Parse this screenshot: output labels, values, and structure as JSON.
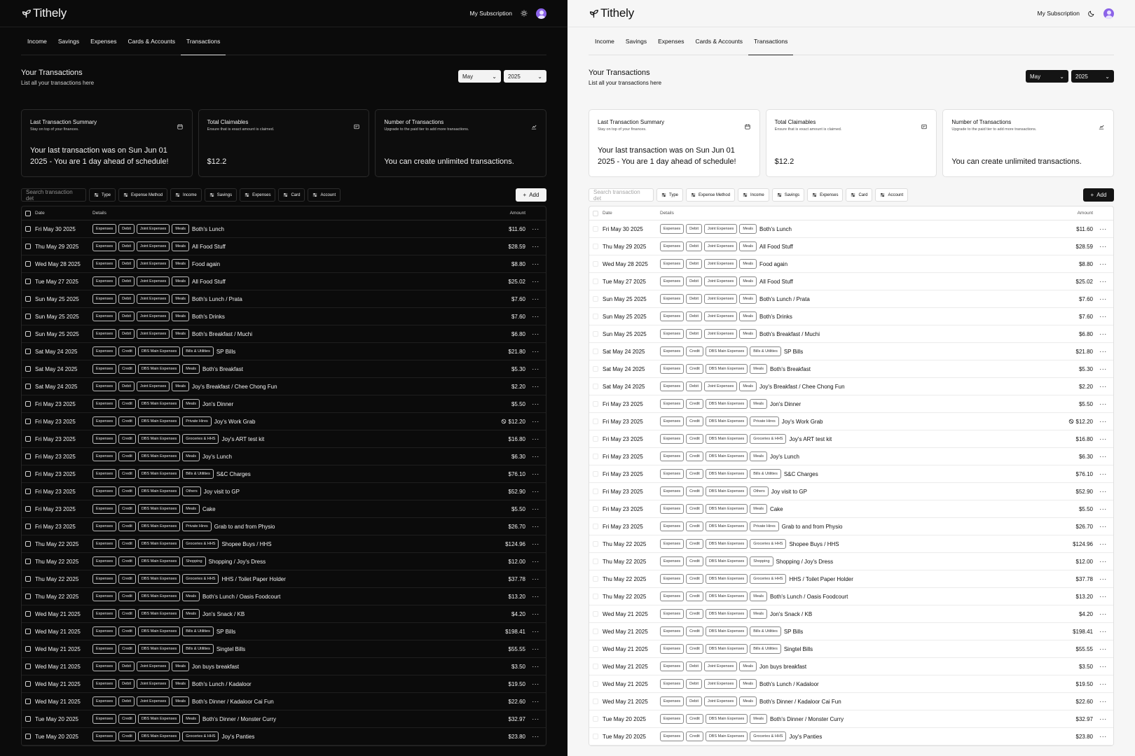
{
  "app": {
    "name": "Tithely",
    "subscription_label": "My Subscription"
  },
  "tabs": [
    "Income",
    "Savings",
    "Expenses",
    "Cards & Accounts",
    "Transactions"
  ],
  "active_tab": "Transactions",
  "page": {
    "title": "Your Transactions",
    "subtitle": "List all your transactions here"
  },
  "month_select": "May",
  "year_select": "2025",
  "cards": [
    {
      "title": "Last Transaction Summary",
      "subtitle": "Stay on top of your finances.",
      "value": "Your last transaction was on Sun Jun 01 2025 - You are 1 day ahead of schedule!",
      "icon": "calendar-icon"
    },
    {
      "title": "Total Claimables",
      "subtitle": "Ensure that is exact amount is claimed.",
      "value": "$12.2",
      "icon": "receipt-icon"
    },
    {
      "title": "Number of Transactions",
      "subtitle": "Upgrade to the paid tier to add more transactions.",
      "value": "You can create unlimited transactions.",
      "icon": "chart-icon"
    }
  ],
  "search_placeholder": "Search transaction det",
  "filters": [
    "Type",
    "Expense Method",
    "Income",
    "Savings",
    "Expenses",
    "Card",
    "Account"
  ],
  "add_label": "Add",
  "table_headers": {
    "date": "Date",
    "details": "Details",
    "amount": "Amount"
  },
  "rows": [
    {
      "date": "Fri May 30 2025",
      "tags": [
        "Expenses",
        "Debit",
        "Joint Expenses",
        "Meals"
      ],
      "desc": "Both's Lunch",
      "amount": "$11.60",
      "claim": false
    },
    {
      "date": "Thu May 29 2025",
      "tags": [
        "Expenses",
        "Debit",
        "Joint Expenses",
        "Meals"
      ],
      "desc": "All Food Stuff",
      "amount": "$28.59",
      "claim": false
    },
    {
      "date": "Wed May 28 2025",
      "tags": [
        "Expenses",
        "Debit",
        "Joint Expenses",
        "Meals"
      ],
      "desc": "Food again",
      "amount": "$8.80",
      "claim": false
    },
    {
      "date": "Tue May 27 2025",
      "tags": [
        "Expenses",
        "Debit",
        "Joint Expenses",
        "Meals"
      ],
      "desc": "All Food Stuff",
      "amount": "$25.02",
      "claim": false
    },
    {
      "date": "Sun May 25 2025",
      "tags": [
        "Expenses",
        "Debit",
        "Joint Expenses",
        "Meals"
      ],
      "desc": "Both's Lunch / Prata",
      "amount": "$7.60",
      "claim": false
    },
    {
      "date": "Sun May 25 2025",
      "tags": [
        "Expenses",
        "Debit",
        "Joint Expenses",
        "Meals"
      ],
      "desc": "Both's Drinks",
      "amount": "$7.60",
      "claim": false
    },
    {
      "date": "Sun May 25 2025",
      "tags": [
        "Expenses",
        "Debit",
        "Joint Expenses",
        "Meals"
      ],
      "desc": "Both's Breakfast / Muchi",
      "amount": "$6.80",
      "claim": false
    },
    {
      "date": "Sat May 24 2025",
      "tags": [
        "Expenses",
        "Credit",
        "DBS Main Expenses",
        "Bills & Utilities"
      ],
      "desc": "SP Bills",
      "amount": "$21.80",
      "claim": false
    },
    {
      "date": "Sat May 24 2025",
      "tags": [
        "Expenses",
        "Credit",
        "DBS Main Expenses",
        "Meals"
      ],
      "desc": "Both's Breakfast",
      "amount": "$5.30",
      "claim": false
    },
    {
      "date": "Sat May 24 2025",
      "tags": [
        "Expenses",
        "Debit",
        "Joint Expenses",
        "Meals"
      ],
      "desc": "Joy's Breakfast / Chee Chong Fun",
      "amount": "$2.20",
      "claim": false
    },
    {
      "date": "Fri May 23 2025",
      "tags": [
        "Expenses",
        "Credit",
        "DBS Main Expenses",
        "Meals"
      ],
      "desc": "Jon's Dinner",
      "amount": "$5.50",
      "claim": false
    },
    {
      "date": "Fri May 23 2025",
      "tags": [
        "Expenses",
        "Credit",
        "DBS Main Expenses",
        "Private Hires"
      ],
      "desc": "Joy's Work Grab",
      "amount": "$12.20",
      "claim": true
    },
    {
      "date": "Fri May 23 2025",
      "tags": [
        "Expenses",
        "Credit",
        "DBS Main Expenses",
        "Groceries & HHS"
      ],
      "desc": "Joy's ART test kit",
      "amount": "$16.80",
      "claim": false
    },
    {
      "date": "Fri May 23 2025",
      "tags": [
        "Expenses",
        "Credit",
        "DBS Main Expenses",
        "Meals"
      ],
      "desc": "Joy's Lunch",
      "amount": "$6.30",
      "claim": false
    },
    {
      "date": "Fri May 23 2025",
      "tags": [
        "Expenses",
        "Credit",
        "DBS Main Expenses",
        "Bills & Utilities"
      ],
      "desc": "S&C Charges",
      "amount": "$76.10",
      "claim": false
    },
    {
      "date": "Fri May 23 2025",
      "tags": [
        "Expenses",
        "Credit",
        "DBS Main Expenses",
        "Others"
      ],
      "desc": "Joy visit to GP",
      "amount": "$52.90",
      "claim": false
    },
    {
      "date": "Fri May 23 2025",
      "tags": [
        "Expenses",
        "Credit",
        "DBS Main Expenses",
        "Meals"
      ],
      "desc": "Cake",
      "amount": "$5.50",
      "claim": false
    },
    {
      "date": "Fri May 23 2025",
      "tags": [
        "Expenses",
        "Credit",
        "DBS Main Expenses",
        "Private Hires"
      ],
      "desc": "Grab to and from Physio",
      "amount": "$26.70",
      "claim": false
    },
    {
      "date": "Thu May 22 2025",
      "tags": [
        "Expenses",
        "Credit",
        "DBS Main Expenses",
        "Groceries & HHS"
      ],
      "desc": "Shopee Buys / HHS",
      "amount": "$124.96",
      "claim": false
    },
    {
      "date": "Thu May 22 2025",
      "tags": [
        "Expenses",
        "Credit",
        "DBS Main Expenses",
        "Shopping"
      ],
      "desc": "Shopping / Joy's Dress",
      "amount": "$12.00",
      "claim": false
    },
    {
      "date": "Thu May 22 2025",
      "tags": [
        "Expenses",
        "Credit",
        "DBS Main Expenses",
        "Groceries & HHS"
      ],
      "desc": "HHS / Toilet Paper Holder",
      "amount": "$37.78",
      "claim": false
    },
    {
      "date": "Thu May 22 2025",
      "tags": [
        "Expenses",
        "Credit",
        "DBS Main Expenses",
        "Meals"
      ],
      "desc": "Both's Lunch / Oasis Foodcourt",
      "amount": "$13.20",
      "claim": false
    },
    {
      "date": "Wed May 21 2025",
      "tags": [
        "Expenses",
        "Credit",
        "DBS Main Expenses",
        "Meals"
      ],
      "desc": "Jon's Snack / KB",
      "amount": "$4.20",
      "claim": false
    },
    {
      "date": "Wed May 21 2025",
      "tags": [
        "Expenses",
        "Credit",
        "DBS Main Expenses",
        "Bills & Utilities"
      ],
      "desc": "SP Bills",
      "amount": "$198.41",
      "claim": false
    },
    {
      "date": "Wed May 21 2025",
      "tags": [
        "Expenses",
        "Credit",
        "DBS Main Expenses",
        "Bills & Utilities"
      ],
      "desc": "Singtel Bills",
      "amount": "$55.55",
      "claim": false
    },
    {
      "date": "Wed May 21 2025",
      "tags": [
        "Expenses",
        "Debit",
        "Joint Expenses",
        "Meals"
      ],
      "desc": "Jon buys breakfast",
      "amount": "$3.50",
      "claim": false
    },
    {
      "date": "Wed May 21 2025",
      "tags": [
        "Expenses",
        "Debit",
        "Joint Expenses",
        "Meals"
      ],
      "desc": "Both's Lunch / Kadaloor",
      "amount": "$19.50",
      "claim": false
    },
    {
      "date": "Wed May 21 2025",
      "tags": [
        "Expenses",
        "Debit",
        "Joint Expenses",
        "Meals"
      ],
      "desc": "Both's Dinner / Kadaloor Cai Fun",
      "amount": "$22.60",
      "claim": false
    },
    {
      "date": "Tue May 20 2025",
      "tags": [
        "Expenses",
        "Credit",
        "DBS Main Expenses",
        "Meals"
      ],
      "desc": "Both's Dinner / Monster Curry",
      "amount": "$32.97",
      "claim": false
    },
    {
      "date": "Tue May 20 2025",
      "tags": [
        "Expenses",
        "Credit",
        "DBS Main Expenses",
        "Groceries & HHS"
      ],
      "desc": "Joy's Panties",
      "amount": "$23.80",
      "claim": false
    }
  ]
}
